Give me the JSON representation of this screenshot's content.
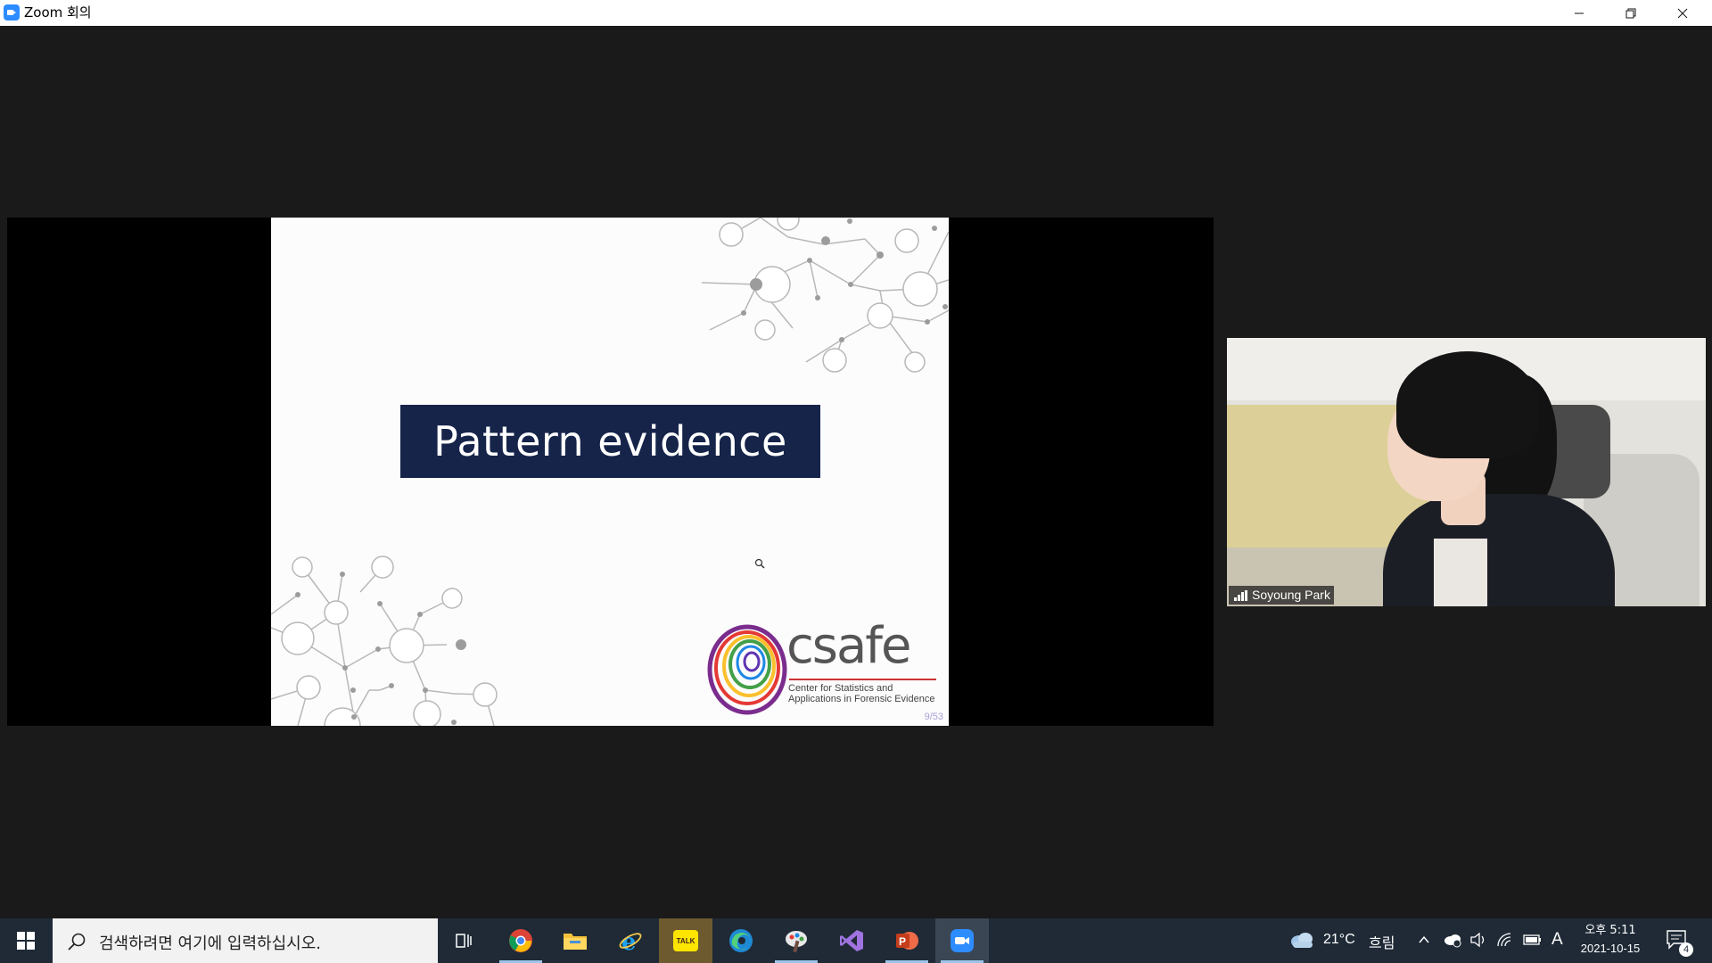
{
  "window": {
    "title": "Zoom 회의",
    "minimize_icon": "minimize-icon",
    "restore_icon": "restore-icon",
    "close_icon": "close-icon"
  },
  "slide": {
    "title": "Pattern evidence",
    "logo_word": "csafe",
    "logo_subtitle_line1": "Center for Statistics and",
    "logo_subtitle_line2": "Applications in Forensic Evidence",
    "page_number": "9/53",
    "network_color": "#b8b8b8",
    "title_box_color": "#16244a"
  },
  "participant": {
    "name": "Soyoung Park",
    "signal_icon": "signal-strength-icon"
  },
  "taskbar": {
    "search_placeholder": "검색하려면 여기에 입력하십시오.",
    "weather_temp": "21°C",
    "weather_desc": "흐림",
    "ime_label": "A",
    "time": "오후 5:11",
    "date": "2021-10-15",
    "notification_count": "4",
    "apps": [
      "task-view",
      "chrome",
      "file-explorer",
      "internet-explorer",
      "kakaotalk",
      "edge",
      "paint",
      "visual-studio",
      "powerpoint",
      "zoom"
    ],
    "kakao_label": "TALK"
  },
  "colors": {
    "background": "#1a1a1a",
    "taskbar": "#1f2a36",
    "zoom_blue": "#2d8cff"
  }
}
